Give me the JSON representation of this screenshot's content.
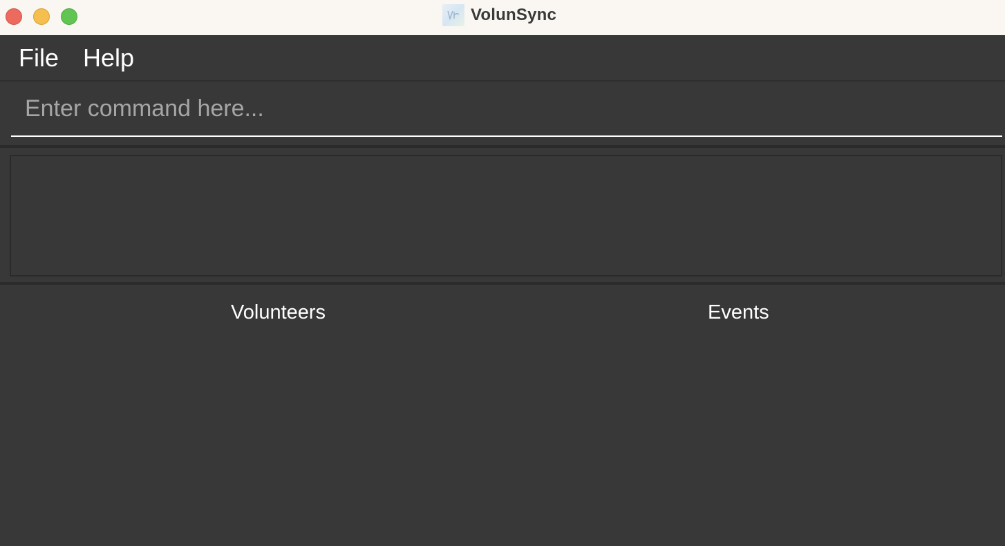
{
  "window": {
    "title": "VolunSync",
    "app_icon": "volunsync-logo-icon"
  },
  "menubar": {
    "file_label": "File",
    "help_label": "Help"
  },
  "command": {
    "placeholder": "Enter command here...",
    "value": ""
  },
  "result": {
    "text": ""
  },
  "lists": {
    "volunteers_title": "Volunteers",
    "events_title": "Events"
  },
  "colors": {
    "titlebar": "#faf7f2",
    "background": "#383838",
    "close": "#ec6a5e",
    "minimize": "#f4bf4f",
    "zoom": "#61c554"
  }
}
